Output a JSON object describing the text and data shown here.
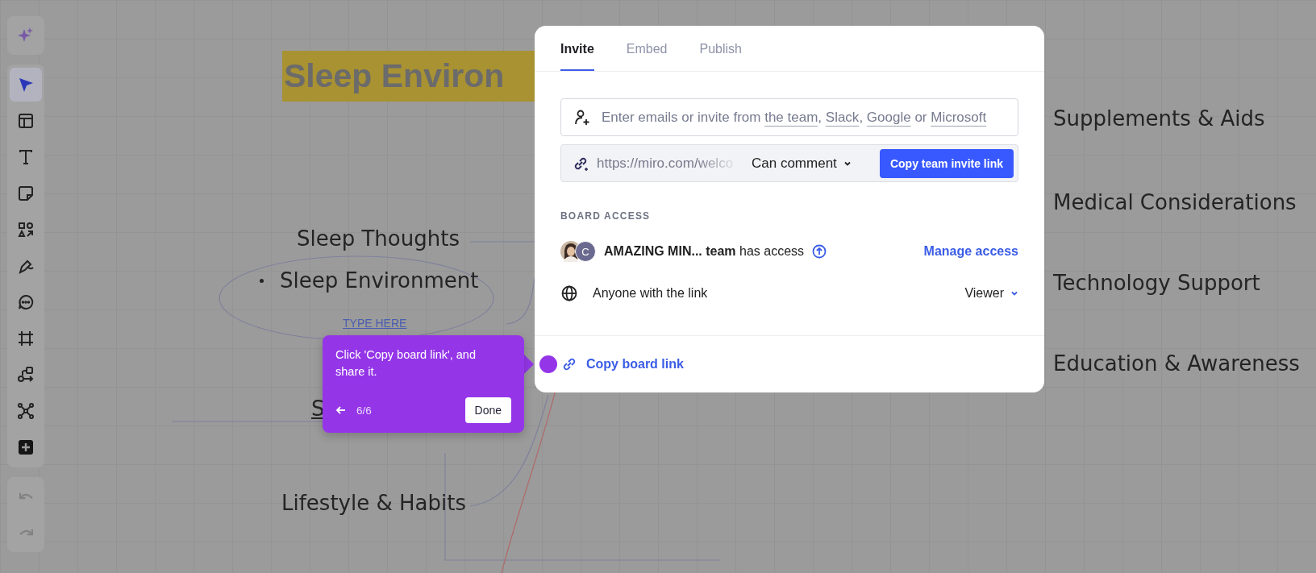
{
  "toolbar": {
    "magic_button": {
      "selected": false
    },
    "tools": [
      {
        "kind": "select",
        "selected": true
      },
      {
        "kind": "layout",
        "selected": false
      },
      {
        "kind": "text",
        "selected": false
      },
      {
        "kind": "sticky",
        "selected": false
      },
      {
        "kind": "shapes",
        "selected": false
      },
      {
        "kind": "pen",
        "selected": false
      },
      {
        "kind": "comment",
        "selected": false
      },
      {
        "kind": "frame",
        "selected": false
      },
      {
        "kind": "flow",
        "selected": false
      },
      {
        "kind": "mindmap",
        "selected": false
      },
      {
        "kind": "add",
        "selected": false
      }
    ],
    "history": [
      {
        "kind": "undo",
        "disabled": true
      },
      {
        "kind": "redo",
        "disabled": true
      }
    ]
  },
  "canvas": {
    "title": "Sleep Environ",
    "left_nodes": [
      {
        "text": "Sleep Thoughts",
        "kind": "plain"
      },
      {
        "text": "Sleep Environment",
        "kind": "bullet"
      },
      {
        "text": "TYPE HERE",
        "kind": "link"
      },
      {
        "text": "S",
        "kind": "partial"
      },
      {
        "text": "Lifestyle & Habits",
        "kind": "plain"
      }
    ],
    "right_nodes": [
      "Supplements & Aids",
      "Medical Considerations",
      "Technology Support",
      "Education & Awareness"
    ]
  },
  "dialog": {
    "tabs": [
      {
        "label": "Invite",
        "selected": true
      },
      {
        "label": "Embed",
        "selected": false
      },
      {
        "label": "Publish",
        "selected": false
      }
    ],
    "invite_field": {
      "segments": [
        {
          "text": "Enter emails or invite from ",
          "kind": "text"
        },
        {
          "text": "the team",
          "kind": "link"
        },
        {
          "text": ", ",
          "kind": "text"
        },
        {
          "text": "Slack",
          "kind": "link"
        },
        {
          "text": ", ",
          "kind": "text"
        },
        {
          "text": "Google",
          "kind": "link"
        },
        {
          "text": " or ",
          "kind": "text"
        },
        {
          "text": "Microsoft",
          "kind": "link"
        }
      ]
    },
    "link_row": {
      "url": "https://miro.com/welco",
      "permission": "Can comment",
      "button": "Copy team invite link"
    },
    "section_label": "BOARD ACCESS",
    "team": {
      "avatar_letter": "C",
      "text": "**AMAZING MIN... team** has access",
      "action": "Manage access"
    },
    "anyone": {
      "label": "Anyone with the link",
      "role": "Viewer"
    },
    "copy_link": "Copy board link"
  },
  "tour_tip": {
    "text": "Click 'Copy board link', and share it.",
    "step": "6/6",
    "button": "Done"
  }
}
